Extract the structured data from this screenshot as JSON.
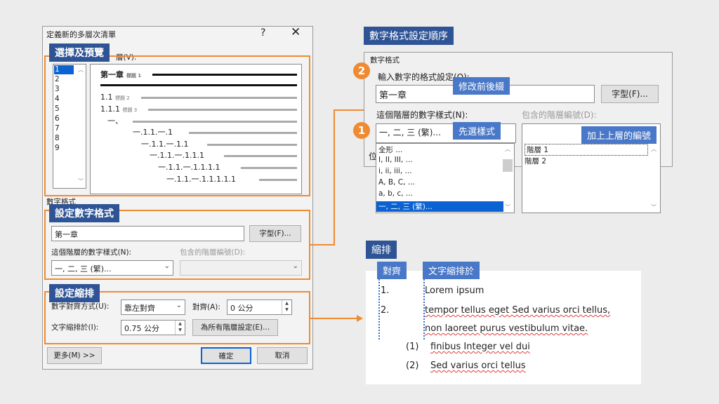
{
  "dialog": {
    "title": "定義新的多層次清單",
    "help": "?",
    "close": "✕",
    "level_caption": "層(V):",
    "levels": [
      "1",
      "2",
      "3",
      "4",
      "5",
      "6",
      "7",
      "8",
      "9"
    ],
    "preview": {
      "line1": "第一章",
      "line1_tag": "標題 1",
      "line2": "1.1",
      "line2_tag": "標題 2",
      "line3": "1.1.1",
      "line3_tag": "標題 3",
      "line4": "一、",
      "line5": "一.1.1.一.1",
      "line6": "一.1.1.一.1.1",
      "line7": "一.1.1.一.1.1.1",
      "line8": "一.1.1.一.1.1.1.1",
      "line9": "一.1.1.一.1.1.1.1.1"
    },
    "format_group_caption": "數字格式",
    "format_input_value": "第一章",
    "font_button": "字型(F)...",
    "style_label": "這個階層的數字樣式(N):",
    "style_value": "一, 二, 三 (繁)...",
    "include_label": "包含的階層編號(D):",
    "align_label": "數字對齊方式(U):",
    "align_value": "靠左對齊",
    "align_at_label": "對齊(A):",
    "align_at_value": "0 公分",
    "indent_label": "文字縮排於(I):",
    "indent_value": "0.75 公分",
    "all_levels_button": "為所有階層設定(E)...",
    "more_button": "更多(M) >>",
    "ok_button": "確定",
    "cancel_button": "取消"
  },
  "annotations": {
    "select_preview": "選擇及預覽",
    "set_format": "設定數字格式",
    "set_indent": "設定縮排"
  },
  "right_panel": {
    "order_title": "數字格式設定順序",
    "group_caption": "數字格式",
    "enter_format_label": "輸入數字的格式設定(O):",
    "format_value": "第一章",
    "font_button": "字型(F)...",
    "style_label": "這個階層的數字樣式(N):",
    "include_label": "包含的階層編號(D):",
    "style_value": "一, 二, 三 (繁)...",
    "style_options": [
      "全形 ...",
      "I, II, III, ...",
      "i, ii, iii, ...",
      "A, B, C, ...",
      "a, b, c, ...",
      "一, 二, 三 (繁)..."
    ],
    "include_options": [
      "階層 1",
      "階層 2"
    ],
    "step1": "1",
    "step2": "2",
    "callout_prefix": "修改前後綴",
    "callout_style": "先選樣式",
    "callout_include": "加上上層的編號",
    "hidden_char": "位"
  },
  "indent_section": {
    "title": "縮排",
    "align_tag": "對齊",
    "indent_tag": "文字縮排於",
    "items": [
      {
        "num": "1.",
        "text": "Lorem ipsum"
      },
      {
        "num": "2.",
        "text": "tempor tellus eget Sed varius orci tellus,"
      },
      {
        "num": "",
        "text": "non laoreet purus vestibulum vitae."
      },
      {
        "num": "(1)",
        "text": "finibus Integer vel dui"
      },
      {
        "num": "(2)",
        "text": "Sed varius orci tellus"
      }
    ]
  },
  "colors": {
    "accent_orange": "#ef8a32",
    "label_blue": "#2f5495",
    "selection_blue": "#0a62d3"
  }
}
